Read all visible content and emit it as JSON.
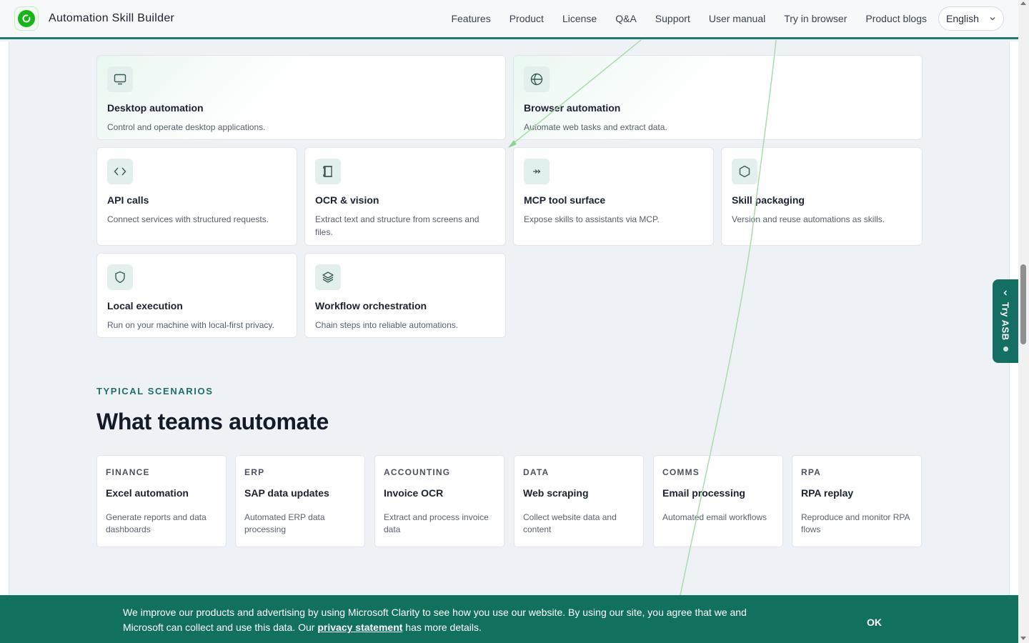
{
  "header": {
    "brand": "Automation Skill Builder",
    "nav": [
      "Features",
      "Product",
      "License",
      "Q&A",
      "Support",
      "User manual",
      "Try in browser",
      "Product blogs"
    ],
    "language": "English"
  },
  "capabilities": [
    {
      "title": "Desktop automation",
      "desc": "Control and operate desktop applications.",
      "icon": "monitor-icon"
    },
    {
      "title": "Browser automation",
      "desc": "Automate web tasks and extract data.",
      "icon": "globe-icon"
    },
    {
      "title": "API calls",
      "desc": "Connect services with structured requests.",
      "icon": "code-icon"
    },
    {
      "title": "OCR & vision",
      "desc": "Extract text and structure from screens and files.",
      "icon": "scan-icon"
    },
    {
      "title": "MCP tool surface",
      "desc": "Expose skills to assistants via MCP.",
      "icon": "plug-icon"
    },
    {
      "title": "Skill packaging",
      "desc": "Version and reuse automations as skills.",
      "icon": "hexagon-icon"
    },
    {
      "title": "Local execution",
      "desc": "Run on your machine with local-first privacy.",
      "icon": "shield-icon"
    },
    {
      "title": "Workflow orchestration",
      "desc": "Chain steps into reliable automations.",
      "icon": "layers-icon"
    }
  ],
  "scenarios": {
    "label": "TYPICAL SCENARIOS",
    "title": "What teams automate",
    "items": [
      {
        "category": "FINANCE",
        "title": "Excel automation",
        "desc": "Generate reports and data dashboards"
      },
      {
        "category": "ERP",
        "title": "SAP data updates",
        "desc": "Automated ERP data processing"
      },
      {
        "category": "ACCOUNTING",
        "title": "Invoice OCR",
        "desc": "Extract and process invoice data"
      },
      {
        "category": "DATA",
        "title": "Web scraping",
        "desc": "Collect website data and content"
      },
      {
        "category": "COMMS",
        "title": "Email processing",
        "desc": "Automated email workflows"
      },
      {
        "category": "RPA",
        "title": "RPA replay",
        "desc": "Reproduce and monitor RPA flows"
      }
    ]
  },
  "side_tab": {
    "label": "Try ASB"
  },
  "cookie": {
    "text_before": "We improve our products and advertising by using Microsoft Clarity to see how you use our website. By using our site, you agree that we and Microsoft can collect and use this data. Our ",
    "link": "privacy statement",
    "text_after": " has more details.",
    "ok": "OK"
  },
  "colors": {
    "accent": "#156e63",
    "brand_green": "#17b51a",
    "page_bg": "#eef2f7"
  }
}
